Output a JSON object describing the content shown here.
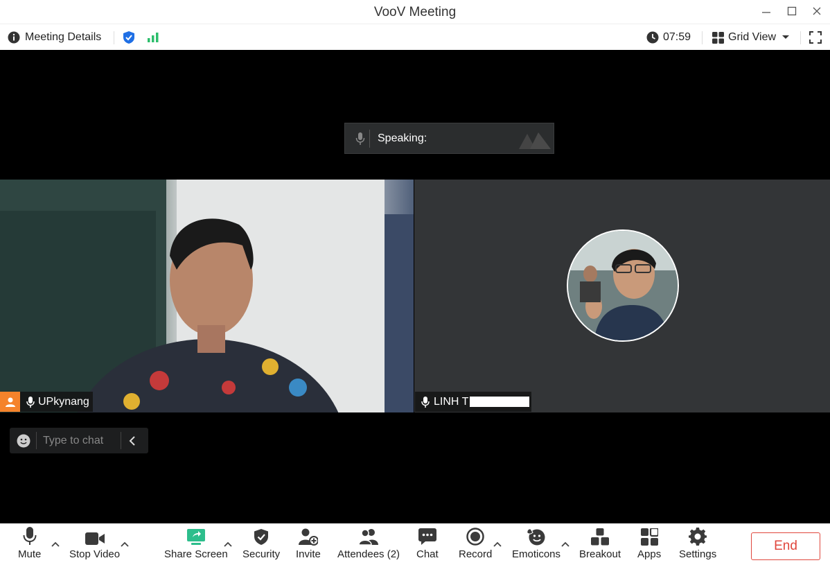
{
  "window": {
    "title": "VooV Meeting"
  },
  "infobar": {
    "meeting_details": "Meeting Details",
    "timer": "07:59",
    "view_mode": "Grid View"
  },
  "speaking": {
    "label": "Speaking:"
  },
  "participants": [
    {
      "name": "UPkynang",
      "role": "host"
    },
    {
      "name": "LINH T"
    }
  ],
  "chat": {
    "placeholder": "Type to chat"
  },
  "toolbar": {
    "mute": "Mute",
    "stop_video": "Stop Video",
    "share_screen": "Share Screen",
    "security": "Security",
    "invite": "Invite",
    "attendees": "Attendees (2)",
    "chat": "Chat",
    "record": "Record",
    "emoticons": "Emoticons",
    "breakout": "Breakout",
    "apps": "Apps",
    "settings": "Settings",
    "end": "End"
  },
  "colors": {
    "end_red": "#e0463c",
    "signal_green": "#2dbe6c",
    "shield_blue": "#1f6fe5",
    "host_orange": "#f5832b",
    "share_green": "#2dbe8c"
  }
}
